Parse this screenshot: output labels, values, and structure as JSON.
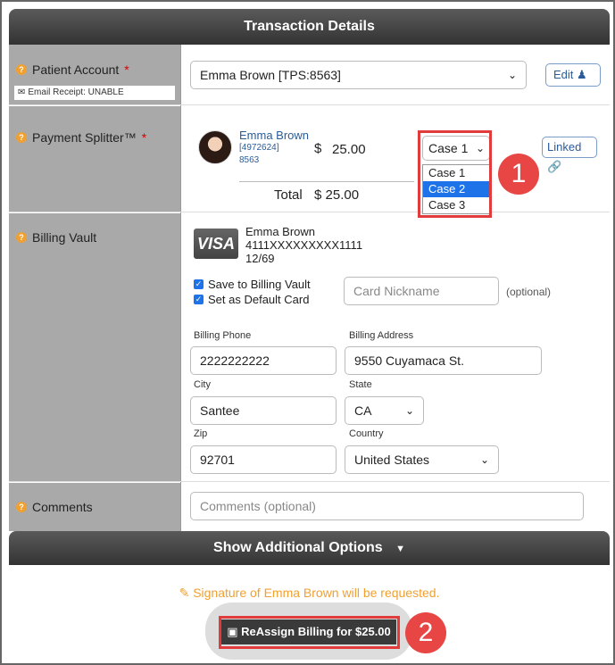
{
  "header": {
    "title": "Transaction Details"
  },
  "patient_account": {
    "label": "Patient Account",
    "required_mark": "*",
    "email_receipt": "Email Receipt: UNABLE",
    "selected_patient": "Emma Brown [TPS:8563]",
    "edit_label": "Edit"
  },
  "payment_splitter": {
    "label": "Payment Splitter™",
    "required_mark": "*",
    "patient_name": "Emma Brown",
    "patient_id": "[4972624]",
    "patient_code": "8563",
    "currency": "$",
    "amount": "25.00",
    "case_selected": "Case 1",
    "case_options": [
      "Case 1",
      "Case 2",
      "Case 3"
    ],
    "highlighted_option": "Case 2",
    "linked_label": "Linked",
    "total_label": "Total",
    "total_value": "$ 25.00"
  },
  "billing_vault": {
    "label": "Billing Vault",
    "card_brand": "VISA",
    "card_holder": "Emma Brown",
    "card_number": "4111XXXXXXXXX1111",
    "card_expiry": "12/69",
    "save_to_vault": "Save to Billing Vault",
    "set_default": "Set as Default Card",
    "nickname_placeholder": "Card Nickname",
    "optional_note": "(optional)",
    "billing_phone_label": "Billing Phone",
    "billing_phone": "2222222222",
    "billing_address_label": "Billing Address",
    "billing_address": "9550 Cuyamaca St.",
    "city_label": "City",
    "city": "Santee",
    "state_label": "State",
    "state": "CA",
    "zip_label": "Zip",
    "zip": "92701",
    "country_label": "Country",
    "country": "United States"
  },
  "comments": {
    "label": "Comments",
    "placeholder": "Comments (optional)"
  },
  "additional_options": {
    "label": "Show Additional Options"
  },
  "signature_note": "Signature of Emma Brown will be requested.",
  "submit_button": "ReAssign Billing for $25.00",
  "callouts": [
    "1",
    "2"
  ],
  "colors": {
    "accent_red": "#e23b3b",
    "link_blue": "#2a5c99",
    "warning_orange": "#f0a030",
    "selected_blue": "#1e73e8"
  }
}
